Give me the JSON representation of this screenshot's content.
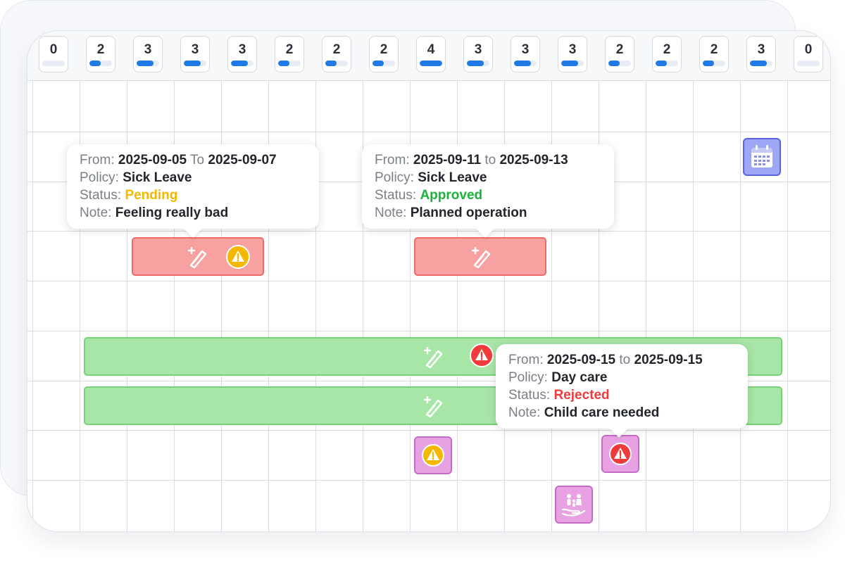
{
  "header": {
    "day_counts": [
      {
        "count": "0",
        "load": 0.0
      },
      {
        "count": "2",
        "load": 0.5
      },
      {
        "count": "3",
        "load": 0.75
      },
      {
        "count": "3",
        "load": 0.75
      },
      {
        "count": "3",
        "load": 0.75
      },
      {
        "count": "2",
        "load": 0.5
      },
      {
        "count": "2",
        "load": 0.5
      },
      {
        "count": "2",
        "load": 0.5
      },
      {
        "count": "4",
        "load": 1.0
      },
      {
        "count": "3",
        "load": 0.75
      },
      {
        "count": "3",
        "load": 0.75
      },
      {
        "count": "3",
        "load": 0.75
      },
      {
        "count": "2",
        "load": 0.5
      },
      {
        "count": "2",
        "load": 0.5
      },
      {
        "count": "2",
        "load": 0.5
      },
      {
        "count": "3",
        "load": 0.75
      },
      {
        "count": "0",
        "load": 0.0
      }
    ]
  },
  "colors": {
    "accent": "#1f7ae8",
    "sick_bar": "#f8a1a1",
    "vacation_bar": "#a8e6a8",
    "day_care_tile": "#e8a2e4",
    "calendar_tile": "#9ea7f5",
    "pending": "#f5b800",
    "approved": "#1db23b",
    "rejected": "#ef3b3b"
  },
  "icons": {
    "bar_icon": "thermometer-plus-icon",
    "pending_badge": "warning-triangle-icon",
    "rejected_badge": "warning-triangle-icon",
    "calendar": "calendar-icon",
    "day_care": "family-hand-icon"
  },
  "tooltips": [
    {
      "from_label": "From:",
      "from": "2025-09-05",
      "to_label": "To",
      "to": "2025-09-07",
      "policy_label": "Policy:",
      "policy": "Sick Leave",
      "status_label": "Status:",
      "status": "Pending",
      "note_label": "Note:",
      "note": "Feeling really bad"
    },
    {
      "from_label": "From:",
      "from": "2025-09-11",
      "to_label": "to",
      "to": "2025-09-13",
      "policy_label": "Policy:",
      "policy": "Sick Leave",
      "status_label": "Status:",
      "status": "Approved",
      "note_label": "Note:",
      "note": "Planned operation"
    },
    {
      "from_label": "From:",
      "from": "2025-09-15",
      "to_label": "to",
      "to": "2025-09-15",
      "policy_label": "Policy:",
      "policy": "Day care",
      "status_label": "Status:",
      "status": "Rejected",
      "note_label": "Note:",
      "note": "Child care needed"
    }
  ]
}
